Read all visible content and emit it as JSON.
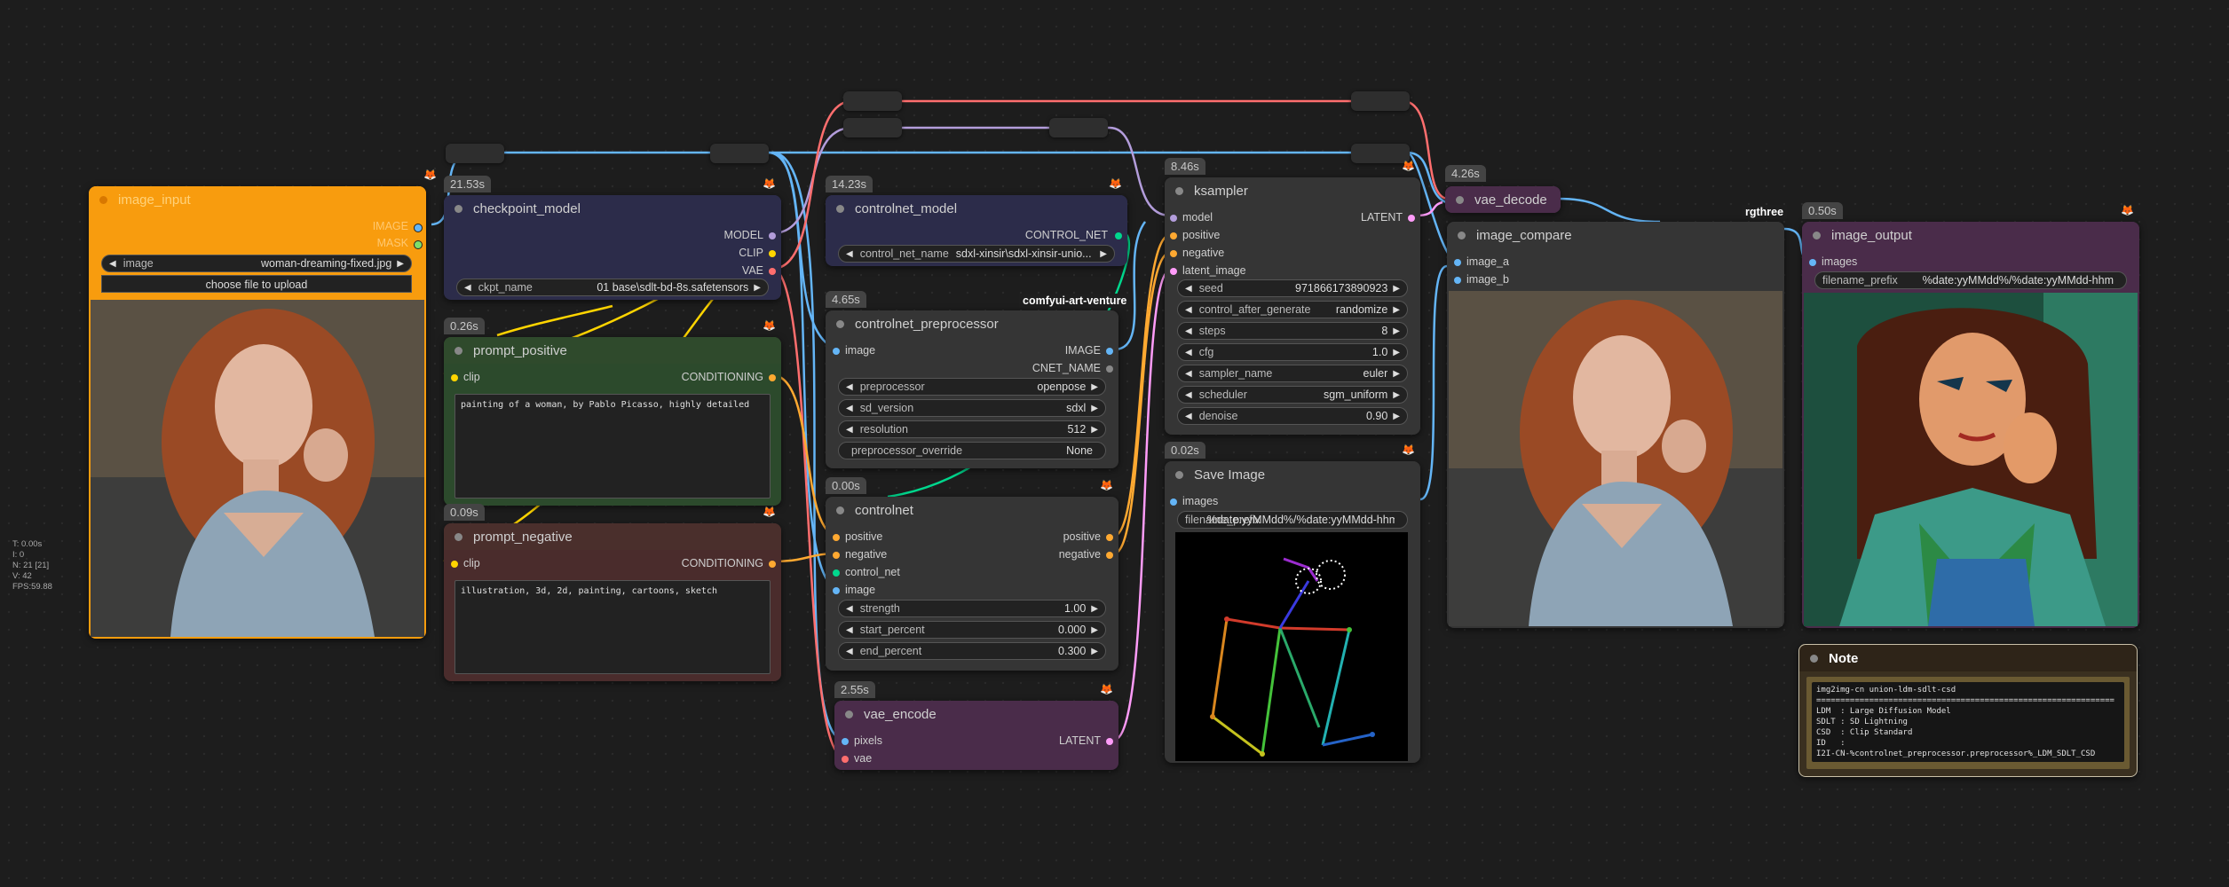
{
  "canvas": {
    "stats": [
      "T: 0.00s",
      "I: 0",
      "N: 21 [21]",
      "V: 42",
      "FPS:59.88"
    ],
    "tags": {
      "art_venture": "comfyui-art-venture",
      "rgthree": "rgthree"
    }
  },
  "nodes": {
    "image_input": {
      "title": "image_input",
      "outputs": [
        "IMAGE",
        "MASK"
      ],
      "image_widget": {
        "label": "image",
        "value": "woman-dreaming-fixed.jpg"
      },
      "upload_label": "choose file to upload"
    },
    "checkpoint_model": {
      "time": "21.53s",
      "title": "checkpoint_model",
      "outputs": [
        "MODEL",
        "CLIP",
        "VAE"
      ],
      "ckpt": {
        "label": "ckpt_name",
        "value": "01 base\\sdlt-bd-8s.safetensors"
      }
    },
    "prompt_positive": {
      "time": "0.26s",
      "title": "prompt_positive",
      "input": "clip",
      "output": "CONDITIONING",
      "text": "painting of a woman, by Pablo Picasso, highly detailed"
    },
    "prompt_negative": {
      "time": "0.09s",
      "title": "prompt_negative",
      "input": "clip",
      "output": "CONDITIONING",
      "text": "illustration, 3d, 2d, painting, cartoons, sketch"
    },
    "controlnet_model": {
      "time": "14.23s",
      "title": "controlnet_model",
      "output": "CONTROL_NET",
      "widget": {
        "label": "control_net_name",
        "value": "sdxl-xinsir\\sdxl-xinsir-unio..."
      }
    },
    "controlnet_preprocessor": {
      "time": "4.65s",
      "title": "controlnet_preprocessor",
      "input": "image",
      "outputs": [
        "IMAGE",
        "CNET_NAME"
      ],
      "widgets": [
        {
          "label": "preprocessor",
          "value": "openpose"
        },
        {
          "label": "sd_version",
          "value": "sdxl"
        },
        {
          "label": "resolution",
          "value": "512"
        }
      ],
      "override": {
        "label": "preprocessor_override",
        "value": "None"
      }
    },
    "controlnet": {
      "time": "0.00s",
      "title": "controlnet",
      "inputs": [
        "positive",
        "negative",
        "control_net",
        "image"
      ],
      "outputs": [
        "positive",
        "negative"
      ],
      "widgets": [
        {
          "label": "strength",
          "value": "1.00"
        },
        {
          "label": "start_percent",
          "value": "0.000"
        },
        {
          "label": "end_percent",
          "value": "0.300"
        }
      ]
    },
    "vae_encode": {
      "time": "2.55s",
      "title": "vae_encode",
      "inputs": [
        "pixels",
        "vae"
      ],
      "output": "LATENT"
    },
    "ksampler": {
      "time": "8.46s",
      "title": "ksampler",
      "inputs": [
        "model",
        "positive",
        "negative",
        "latent_image"
      ],
      "output": "LATENT",
      "widgets": [
        {
          "label": "seed",
          "value": "971866173890923"
        },
        {
          "label": "control_after_generate",
          "value": "randomize"
        },
        {
          "label": "steps",
          "value": "8"
        },
        {
          "label": "cfg",
          "value": "1.0"
        },
        {
          "label": "sampler_name",
          "value": "euler"
        },
        {
          "label": "scheduler",
          "value": "sgm_uniform"
        },
        {
          "label": "denoise",
          "value": "0.90"
        }
      ]
    },
    "save_image": {
      "time": "0.02s",
      "title": "Save Image",
      "input": "images",
      "prefix": {
        "label": "filename_prefix",
        "value": "%date:yyMMdd%/%date:yyMMdd-hhm"
      }
    },
    "vae_decode": {
      "time": "4.26s",
      "title": "vae_decode"
    },
    "image_compare": {
      "title": "image_compare",
      "inputs": [
        "image_a",
        "image_b"
      ]
    },
    "image_output": {
      "time": "0.50s",
      "title": "image_output",
      "input": "images",
      "prefix": {
        "label": "filename_prefix",
        "value": "%date:yyMMdd%/%date:yyMMdd-hhm"
      }
    },
    "note": {
      "title": "Note",
      "text": "img2img-cn union-ldm-sdlt-csd\n==============================================================\nLDM  : Large Diffusion Model\nSDLT : SD Lightning\nCSD  : Clip Standard\nID   :\nI2I-CN-%controlnet_preprocessor.preprocessor%_LDM_SDLT_CSD"
    }
  },
  "colors": {
    "model": "#b39ddb",
    "clip": "#ffd500",
    "vae": "#ff6e6e",
    "conditioning": "#ffa931",
    "image": "#64b5f6",
    "latent": "#ff9cf9",
    "control_net": "#00d78d",
    "int": "#7fdf6a"
  }
}
